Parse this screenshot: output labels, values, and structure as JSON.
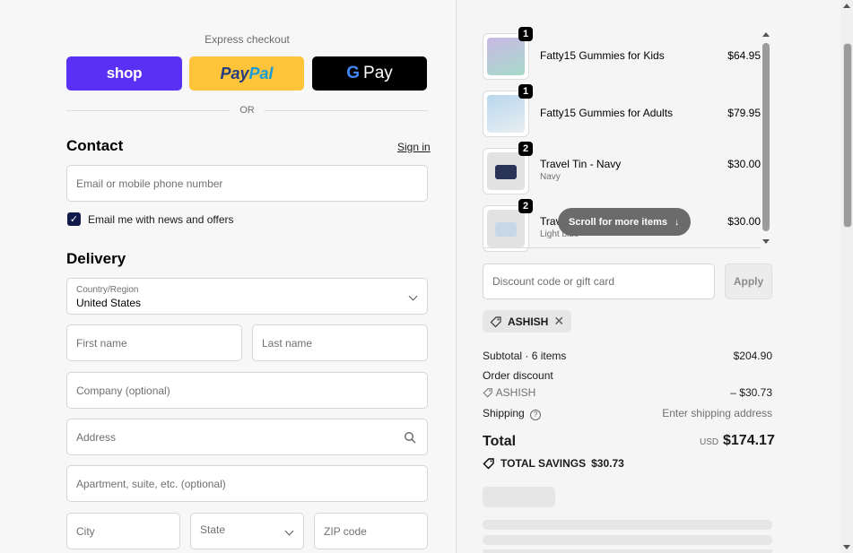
{
  "express": {
    "title": "Express checkout",
    "shop_label": "shop",
    "paypal_label_1": "Pay",
    "paypal_label_2": "Pal",
    "gpay_label": "Pay",
    "or_label": "OR"
  },
  "contact": {
    "heading": "Contact",
    "signin_label": "Sign in",
    "email_placeholder": "Email or mobile phone number",
    "newsletter_label": "Email me with news and offers",
    "newsletter_checked": true
  },
  "delivery": {
    "heading": "Delivery",
    "country_label": "Country/Region",
    "country_value": "United States",
    "first_name": "First name",
    "last_name": "Last name",
    "company": "Company (optional)",
    "address": "Address",
    "apartment": "Apartment, suite, etc. (optional)",
    "city": "City",
    "state": "State",
    "zip": "ZIP code"
  },
  "cart": {
    "items": [
      {
        "name": "Fatty15 Gummies for Kids",
        "variant": "",
        "qty": "1",
        "price": "$64.95"
      },
      {
        "name": "Fatty15 Gummies for Adults",
        "variant": "",
        "qty": "1",
        "price": "$79.95"
      },
      {
        "name": "Travel Tin - Navy",
        "variant": "Navy",
        "qty": "2",
        "price": "$30.00"
      },
      {
        "name": "Trav",
        "variant": "Light blue",
        "qty": "2",
        "price": "$30.00"
      }
    ],
    "scroll_hint": "Scroll for more items"
  },
  "discount": {
    "placeholder": "Discount code or gift card",
    "apply_label": "Apply",
    "applied_code": "ASHISH"
  },
  "summary": {
    "subtotal_label": "Subtotal · 6 items",
    "subtotal_value": "$204.90",
    "order_discount_label": "Order discount",
    "discount_code": "ASHISH",
    "discount_value": "– $30.73",
    "shipping_label": "Shipping",
    "shipping_value": "Enter shipping address",
    "total_label": "Total",
    "currency": "USD",
    "total_value": "$174.17",
    "savings_label": "TOTAL SAVINGS",
    "savings_value": "$30.73"
  },
  "colors": {
    "shop": "#5a31f4",
    "paypal": "#ffc439",
    "gpay": "#000000",
    "checkbox": "#121a4a"
  }
}
